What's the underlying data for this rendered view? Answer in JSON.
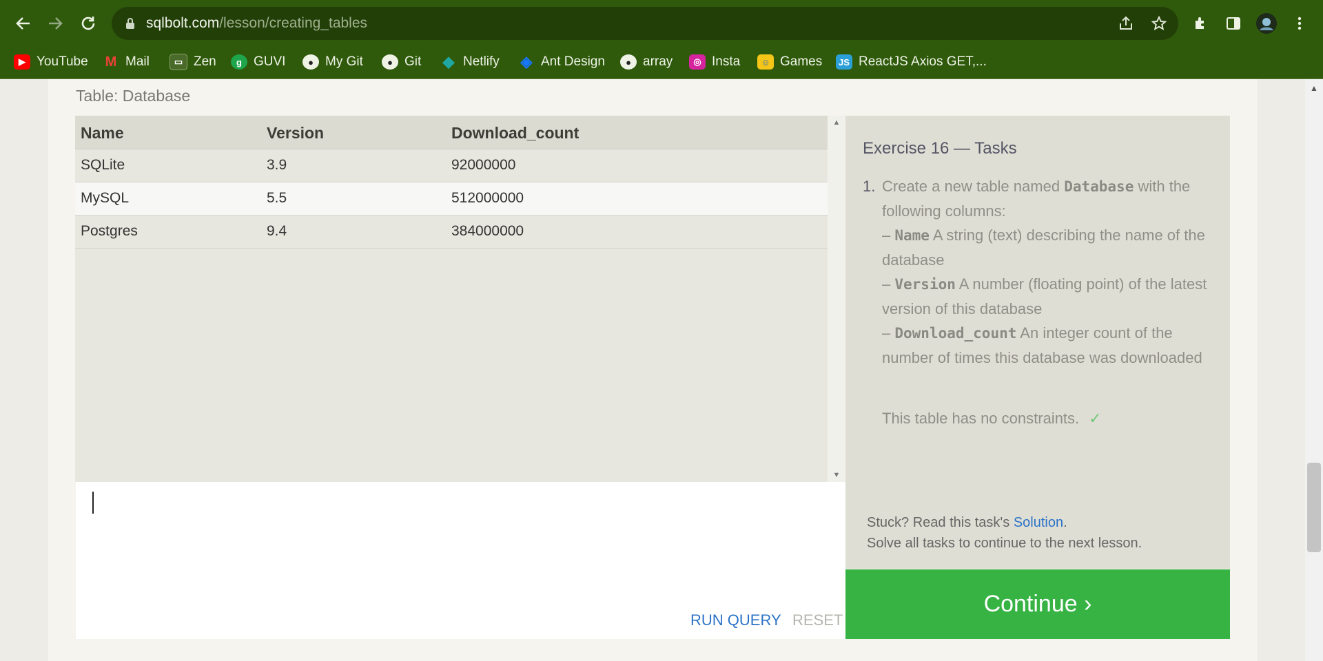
{
  "browser": {
    "url_host": "sqlbolt.com",
    "url_path": "/lesson/creating_tables",
    "bookmarks": [
      {
        "label": "YouTube",
        "icon": "youtube-icon",
        "color": "#ff0000"
      },
      {
        "label": "Mail",
        "icon": "gmail-icon",
        "color": "#ea4335"
      },
      {
        "label": "Zen",
        "icon": "zen-icon",
        "color": "#4a6a2a"
      },
      {
        "label": "GUVI",
        "icon": "guvi-icon",
        "color": "#1fa54c"
      },
      {
        "label": "My Git",
        "icon": "github-icon",
        "color": "#222222"
      },
      {
        "label": "Git",
        "icon": "github-icon",
        "color": "#222222"
      },
      {
        "label": "Netlify",
        "icon": "netlify-icon",
        "color": "#20a7a1"
      },
      {
        "label": "Ant Design",
        "icon": "ant-design-icon",
        "color": "#1677ff"
      },
      {
        "label": "array",
        "icon": "github-icon",
        "color": "#222222"
      },
      {
        "label": "Insta",
        "icon": "instagram-icon",
        "color": "#d6249f"
      },
      {
        "label": "Games",
        "icon": "games-icon",
        "color": "#f5c518"
      },
      {
        "label": "ReactJS Axios GET,...",
        "icon": "js-icon",
        "color": "#2b9fd8"
      }
    ]
  },
  "lesson": {
    "table_title": "Table: Database",
    "columns": [
      "Name",
      "Version",
      "Download_count"
    ],
    "rows": [
      [
        "SQLite",
        "3.9",
        "92000000"
      ],
      [
        "MySQL",
        "5.5",
        "512000000"
      ],
      [
        "Postgres",
        "9.4",
        "384000000"
      ]
    ],
    "editor_value": "",
    "run_label": "RUN QUERY",
    "reset_label": "RESET"
  },
  "tasks": {
    "title": "Exercise 16 — Tasks",
    "number": "1.",
    "intro_a": "Create a new table named",
    "intro_code": "Database",
    "intro_b": "with the following columns:",
    "col1_code": "Name",
    "col1_desc": "A string (text) describing the name of the database",
    "col2_code": "Version",
    "col2_desc": "A number (floating point) of the latest version of this database",
    "col3_code": "Download_count",
    "col3_desc": "An integer count of the number of times this database was downloaded",
    "dash": "–",
    "constraint_note": "This table has no constraints.",
    "check": "✓",
    "stuck_text": "Stuck? Read this task's",
    "solution_link": "Solution",
    "period": ".",
    "solve_text": "Solve all tasks to continue to the next lesson.",
    "continue_label": "Continue ›"
  },
  "colors": {
    "chrome": "#2f5a0c",
    "continue": "#37b344",
    "link": "#2b73c7"
  }
}
